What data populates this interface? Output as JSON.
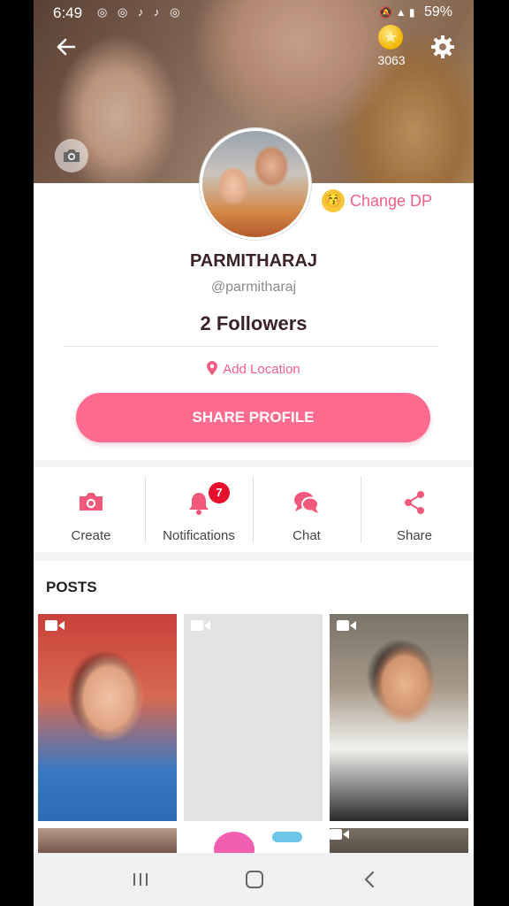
{
  "status_bar": {
    "time": "6:49",
    "left_icons": "◎ ◎ ♪ ♪ ◎",
    "right_text": "59%",
    "right_icons": "🔕 ▲ ▮"
  },
  "header": {
    "coin_count": "3063"
  },
  "profile": {
    "change_dp_label": "Change DP",
    "emoji": "😚",
    "name": "PARMITHARAJ",
    "handle": "@parmitharaj",
    "followers": "2 Followers",
    "add_location_label": "Add Location",
    "share_profile_label": "SHARE PROFILE"
  },
  "actions": [
    {
      "label": "Create",
      "icon": "camera-icon"
    },
    {
      "label": "Notifications",
      "icon": "bell-icon",
      "badge": "7"
    },
    {
      "label": "Chat",
      "icon": "chat-icon"
    },
    {
      "label": "Share",
      "icon": "share-icon"
    }
  ],
  "posts": {
    "title": "POSTS"
  },
  "colors": {
    "accent": "#ff6b8e",
    "accent_text": "#ef5f87",
    "badge": "#e8112d",
    "title_text": "#3a2326"
  }
}
